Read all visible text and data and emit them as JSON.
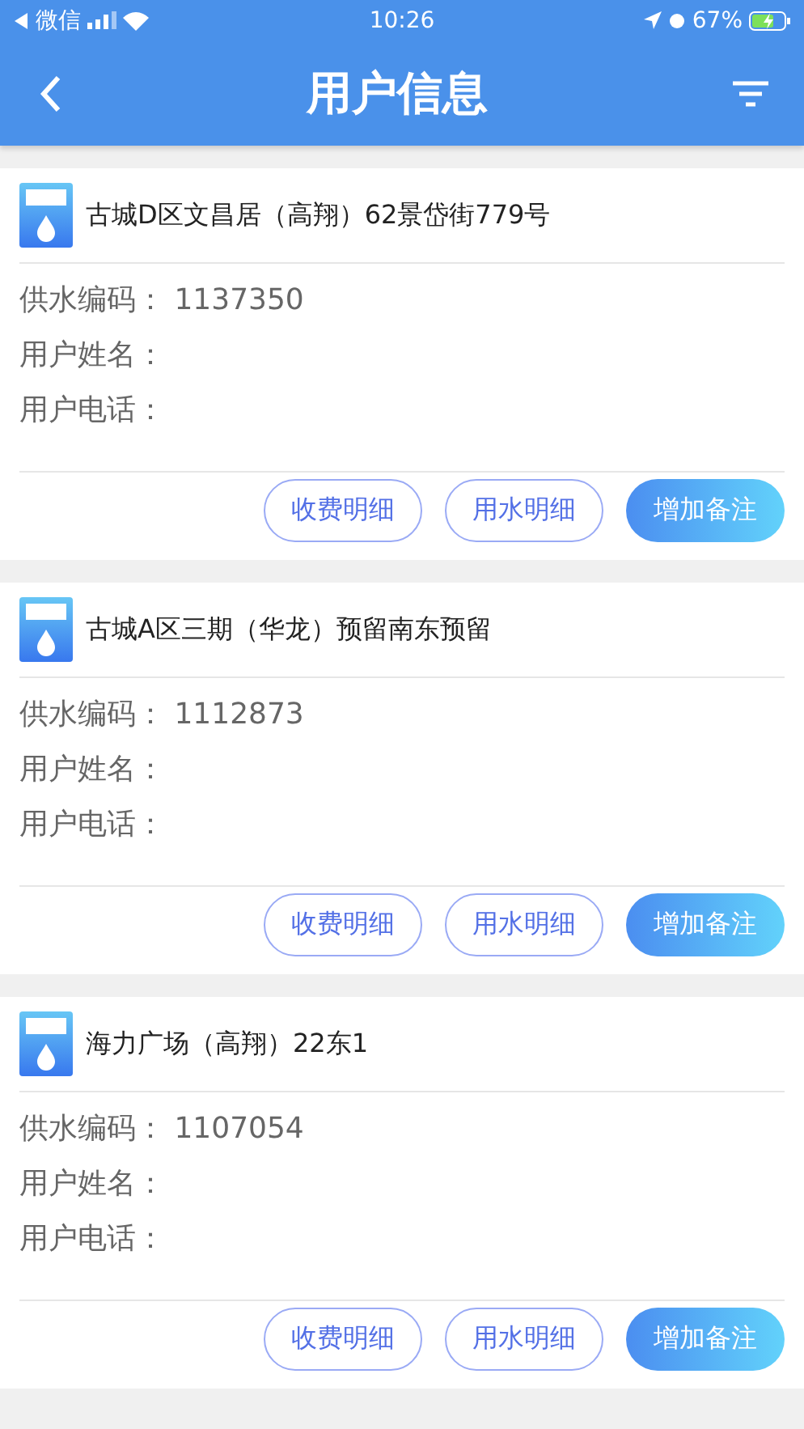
{
  "status_bar": {
    "back_app": "微信",
    "time": "10:26",
    "battery": "67%"
  },
  "nav": {
    "title": "用户信息"
  },
  "cards": [
    {
      "address": "古城D区文昌居（高翔）62景岱街779号",
      "fields": [
        {
          "label": "供水编码：",
          "value": "1137350"
        },
        {
          "label": "用户姓名："
        },
        {
          "label": "用户电话："
        }
      ],
      "buttons": [
        {
          "label": "收费明细",
          "kind": "outline"
        },
        {
          "label": "用水明细",
          "kind": "outline"
        },
        {
          "label": "增加备注",
          "kind": "filled"
        }
      ]
    },
    {
      "address": "古城A区三期（华龙）预留南东预留",
      "fields": [
        {
          "label": "供水编码：",
          "value": "1112873"
        },
        {
          "label": "用户姓名："
        },
        {
          "label": "用户电话："
        }
      ],
      "buttons": [
        {
          "label": "收费明细",
          "kind": "outline"
        },
        {
          "label": "用水明细",
          "kind": "outline"
        },
        {
          "label": "增加备注",
          "kind": "filled"
        }
      ]
    },
    {
      "address": "海力广场（高翔）22东1",
      "fields": [
        {
          "label": "供水编码：",
          "value": "1107054"
        },
        {
          "label": "用户姓名："
        },
        {
          "label": "用户电话："
        }
      ],
      "buttons": [
        {
          "label": "收费明细",
          "kind": "outline"
        },
        {
          "label": "用水明细",
          "kind": "outline"
        },
        {
          "label": "增加备注",
          "kind": "filled"
        }
      ]
    }
  ]
}
